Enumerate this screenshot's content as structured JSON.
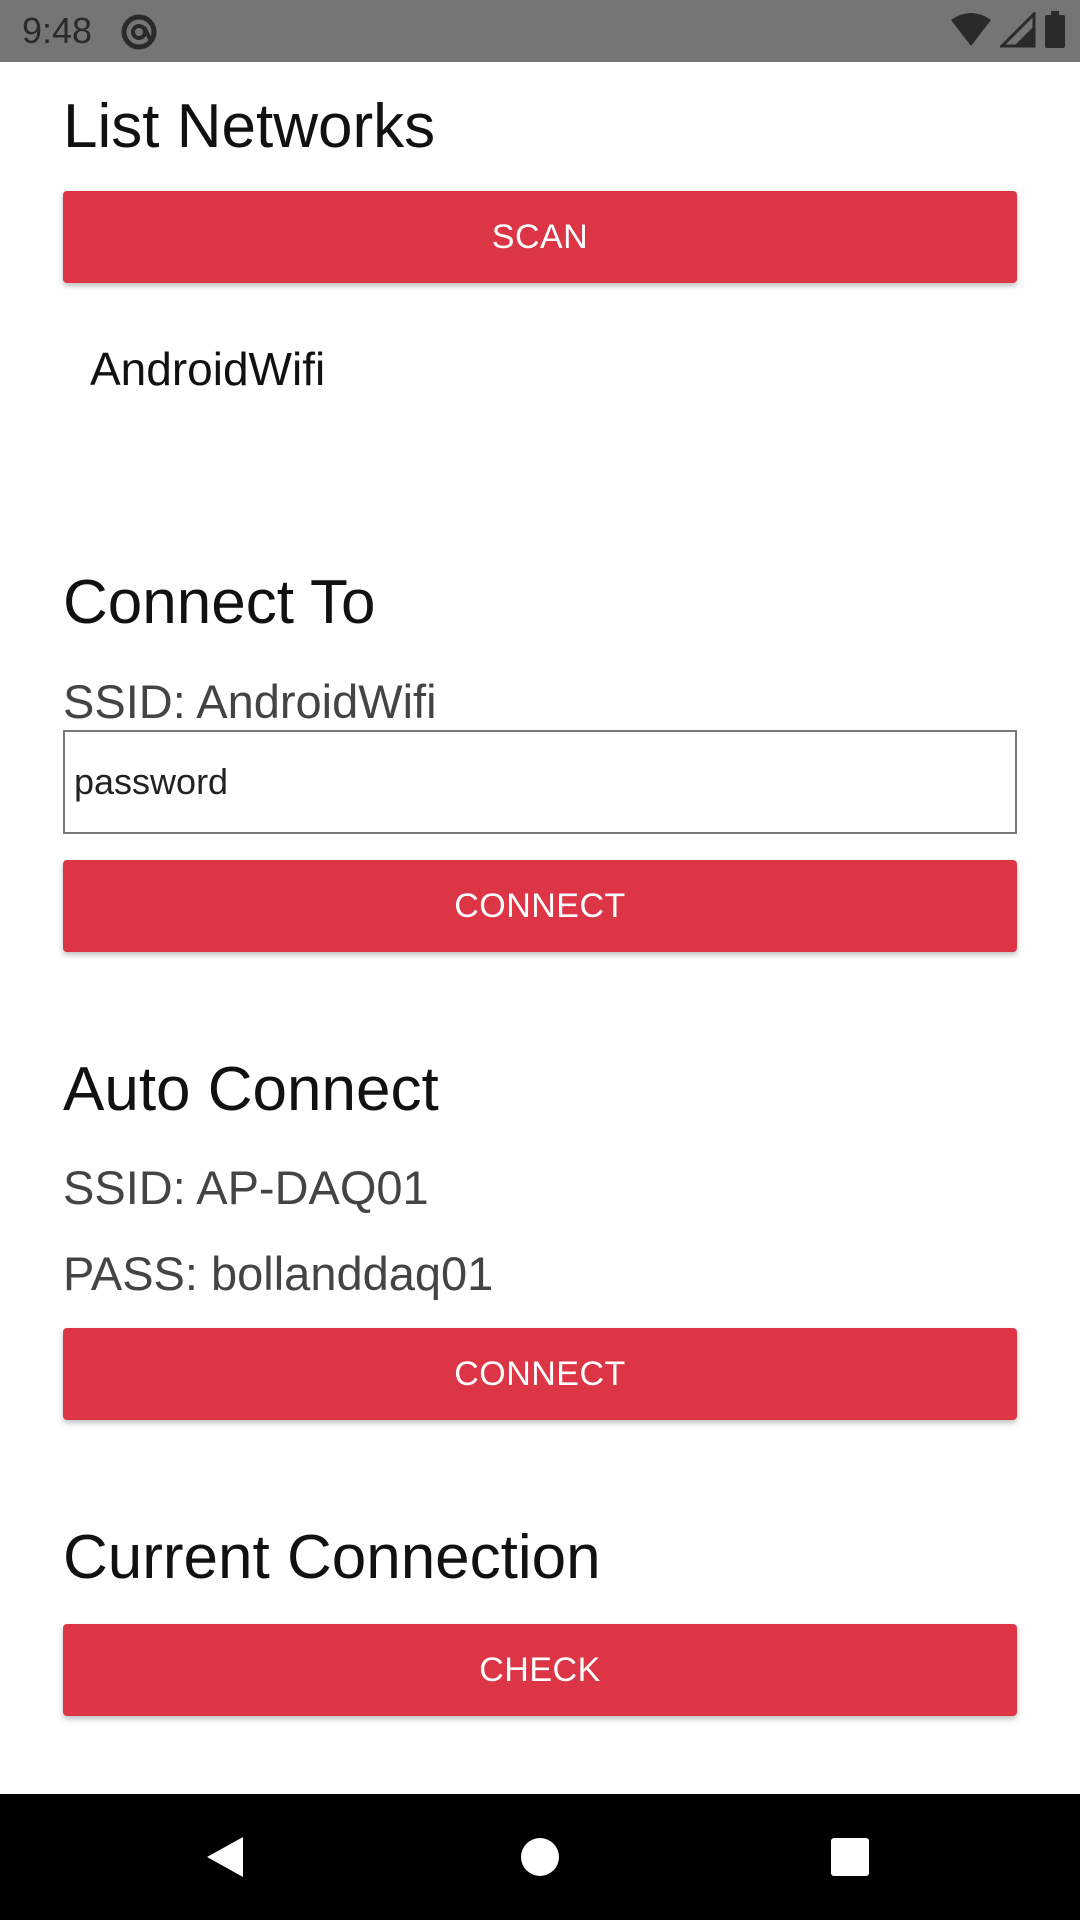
{
  "status_bar": {
    "time": "9:48",
    "icons": [
      "app-notification-icon",
      "wifi-icon",
      "cellular-signal-icon",
      "battery-icon"
    ]
  },
  "sections": {
    "list_networks": {
      "title": "List Networks",
      "scan_label": "SCAN",
      "networks": [
        "AndroidWifi"
      ]
    },
    "connect_to": {
      "title": "Connect To",
      "ssid_text": "SSID: AndroidWifi",
      "password_placeholder": "password",
      "connect_label": "CONNECT"
    },
    "auto_connect": {
      "title": "Auto Connect",
      "ssid_text": "SSID: AP-DAQ01",
      "pass_text": "PASS: bollanddaq01",
      "connect_label": "CONNECT"
    },
    "current_connection": {
      "title": "Current Connection",
      "check_label": "CHECK"
    }
  },
  "nav_bar": {
    "icons": [
      "back-icon",
      "home-icon",
      "recents-icon"
    ]
  },
  "colors": {
    "accent": "#dc3545",
    "status_bar": "#757575",
    "nav_bar": "#000000"
  }
}
